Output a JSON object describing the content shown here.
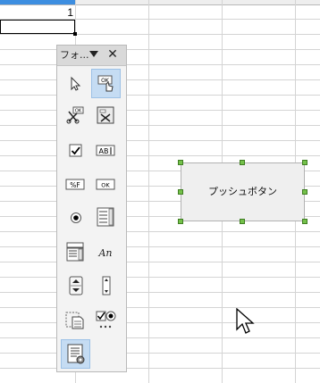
{
  "sheet": {
    "cell_value": "1"
  },
  "toolbar": {
    "title": "フォ...",
    "menu_icon": "dropdown-arrow",
    "close_icon": "close",
    "tools": [
      {
        "name": "select",
        "icon": "pointer-arrow",
        "active": false
      },
      {
        "name": "design-mode",
        "icon": "ok-button-with-hand",
        "active": true
      },
      {
        "name": "control-wizards",
        "icon": "scissors-ok",
        "active": false
      },
      {
        "name": "form-design",
        "icon": "wizard-toolbox",
        "active": false
      },
      {
        "name": "check-box",
        "icon": "checkbox",
        "active": false
      },
      {
        "name": "text-box",
        "icon": "text-box-abc",
        "active": false
      },
      {
        "name": "formatted-field",
        "icon": "formatted-field",
        "active": false
      },
      {
        "name": "push-button",
        "icon": "ok-button",
        "active": false
      },
      {
        "name": "option-button",
        "icon": "radio",
        "active": false
      },
      {
        "name": "list-box",
        "icon": "list-box",
        "active": false
      },
      {
        "name": "combo-box",
        "icon": "combo-box",
        "active": false
      },
      {
        "name": "label-field",
        "icon": "label-an",
        "active": false
      },
      {
        "name": "spin-button",
        "icon": "spin-button",
        "active": false
      },
      {
        "name": "scrollbar",
        "icon": "scrollbar",
        "active": false
      },
      {
        "name": "group-box",
        "icon": "group-box-document",
        "active": false
      },
      {
        "name": "more-controls",
        "icon": "checkbox-radio-more",
        "active": false
      },
      {
        "name": "form-navigator",
        "icon": "form-navigator",
        "active": true
      }
    ]
  },
  "icon_labels": {
    "ok": "OK",
    "abc": "AB",
    "fmt": "%F",
    "an": "An"
  },
  "push_button": {
    "label": "プッシュボタン"
  },
  "colors": {
    "selected_header": "#3d8ee0",
    "toolbar_active": "#c5dcf3",
    "selection_handle": "#74c14a"
  }
}
